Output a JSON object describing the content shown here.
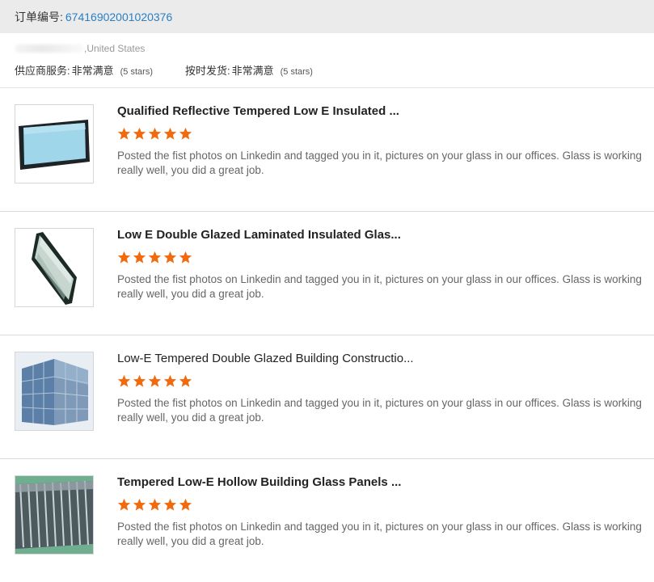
{
  "order": {
    "label": "订单编号:",
    "number": "67416902001020376"
  },
  "buyer": {
    "country": ",United States"
  },
  "ratings": [
    {
      "label": "供应商服务:",
      "value": "非常满意",
      "stars_text": "(5 stars)"
    },
    {
      "label": "按时发货:",
      "value": "非常满意",
      "stars_text": "(5 stars)"
    }
  ],
  "colors": {
    "star": "#f26a0e",
    "link": "#2a7fc4",
    "header_bg": "#ebebeb"
  },
  "reviews": [
    {
      "title": "Qualified Reflective Tempered Low E Insulated ...",
      "rating": 5,
      "image": "blue-insulated-glass-panel",
      "text": "Posted the fist photos on Linkedin and tagged you in it, pictures on your glass in our offices. Glass is working really well, you did a great job."
    },
    {
      "title": "Low E Double Glazed Laminated Insulated Glas...",
      "rating": 5,
      "image": "angled-double-glazed-glass",
      "text": "Posted the fist photos on Linkedin and tagged you in it, pictures on your glass in our offices. Glass is working really well, you did a great job."
    },
    {
      "title": "Low-E Tempered Double Glazed Building Constructio...",
      "rating": 5,
      "image": "glass-facade-building",
      "text": "Posted the fist photos on Linkedin and tagged you in it, pictures on your glass in our offices. Glass is working really well, you did a great job."
    },
    {
      "title": "Tempered Low-E Hollow Building Glass Panels ...",
      "rating": 5,
      "image": "stacked-glass-panels",
      "text": "Posted the fist photos on Linkedin and tagged you in it, pictures on your glass in our offices. Glass is working really well, you did a great job."
    }
  ]
}
